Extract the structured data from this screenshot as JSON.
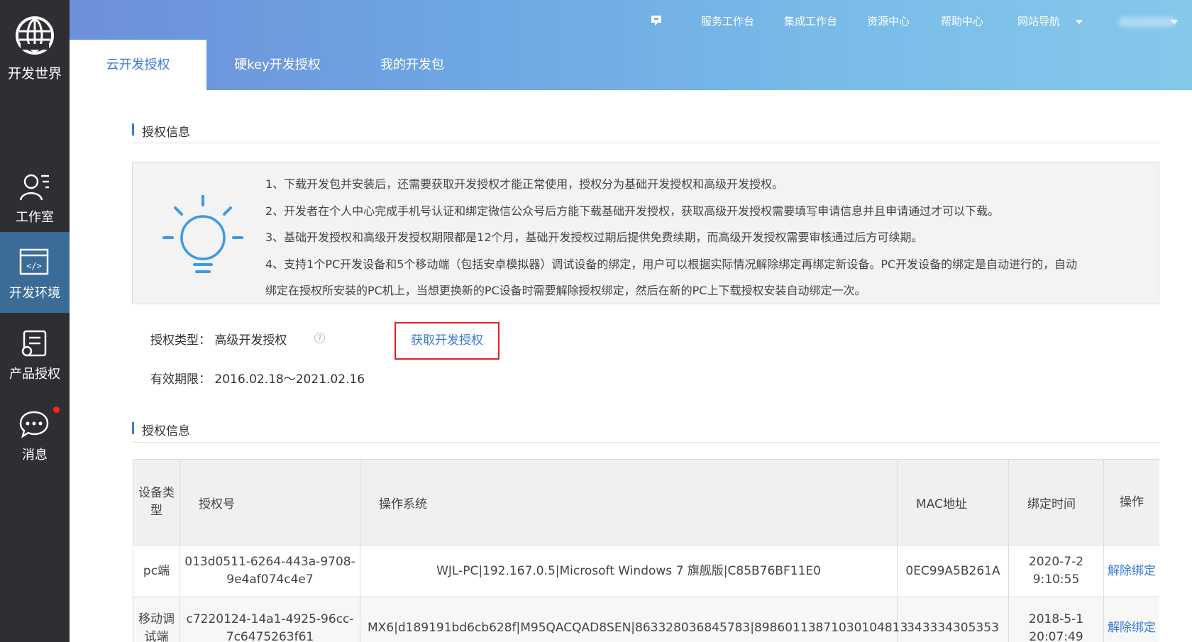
{
  "sidebar": {
    "logo_text": "开发世界",
    "items": [
      {
        "label": "工作室",
        "icon": "user-studio-icon"
      },
      {
        "label": "开发环境",
        "icon": "code-window-icon",
        "active": true
      },
      {
        "label": "产品授权",
        "icon": "certificate-icon"
      },
      {
        "label": "消息",
        "icon": "chat-bubble-icon",
        "badge": true
      }
    ]
  },
  "topnav": {
    "items": [
      "服务工作台",
      "集成工作台",
      "资源中心",
      "帮助中心",
      "网站导航"
    ]
  },
  "tabs": [
    "云开发授权",
    "硬key开发授权",
    "我的开发包"
  ],
  "section1_title": "授权信息",
  "info": {
    "lines": [
      "1、下载开发包并安装后，还需要获取开发授权才能正常使用，授权分为基础开发授权和高级开发授权。",
      "2、开发者在个人中心完成手机号认证和绑定微信公众号后方能下载基础开发授权，获取高级开发授权需要填写申请信息并且申请通过才可以下载。",
      "3、基础开发授权和高级开发授权期限都是12个月，基础开发授权过期后提供免费续期，而高级开发授权需要审核通过后方可续期。",
      "4、支持1个PC开发设备和5个移动端（包括安卓模拟器）调试设备的绑定，用户可以根据实际情况解除绑定再绑定新设备。PC开发设备的绑定是自动进行的，自动",
      "绑定在授权所安装的PC机上，当想更换新的PC设备时需要解除授权绑定，然后在新的PC上下载授权安装自动绑定一次。"
    ]
  },
  "auth": {
    "type_label": "授权类型：",
    "type_value": "高级开发授权",
    "help_glyph": "?",
    "get_button": "获取开发授权",
    "validity_label": "有效期限：",
    "validity_value": "2016.02.18～2021.02.16"
  },
  "section2_title": "授权信息",
  "table": {
    "headers": [
      "设备类型",
      "授权号",
      "操作系统",
      "MAC地址",
      "绑定时间",
      "操作"
    ],
    "rows": [
      {
        "device": "pc端",
        "auth_no": "013d0511-6264-443a-9708-9e4af074c4e7",
        "os": "WJL-PC|192.167.0.5|Microsoft Windows 7 旗舰版|C85B76BF11E0",
        "mac": "0EC99A5B261A",
        "bind_time": "2020-7-2 9:10:55",
        "op": "解除绑定"
      },
      {
        "device": "移动调试端",
        "auth_no": "c7220124-14a1-4925-96cc-7c6475263f61",
        "os": "MX6|d189191bd6cb628f|M95QACQAD8SEN|863328036845783|89860113871030104813",
        "mac": "343334305353",
        "bind_time": "2018-5-1 20:07:49",
        "op": "解除绑定"
      }
    ]
  }
}
